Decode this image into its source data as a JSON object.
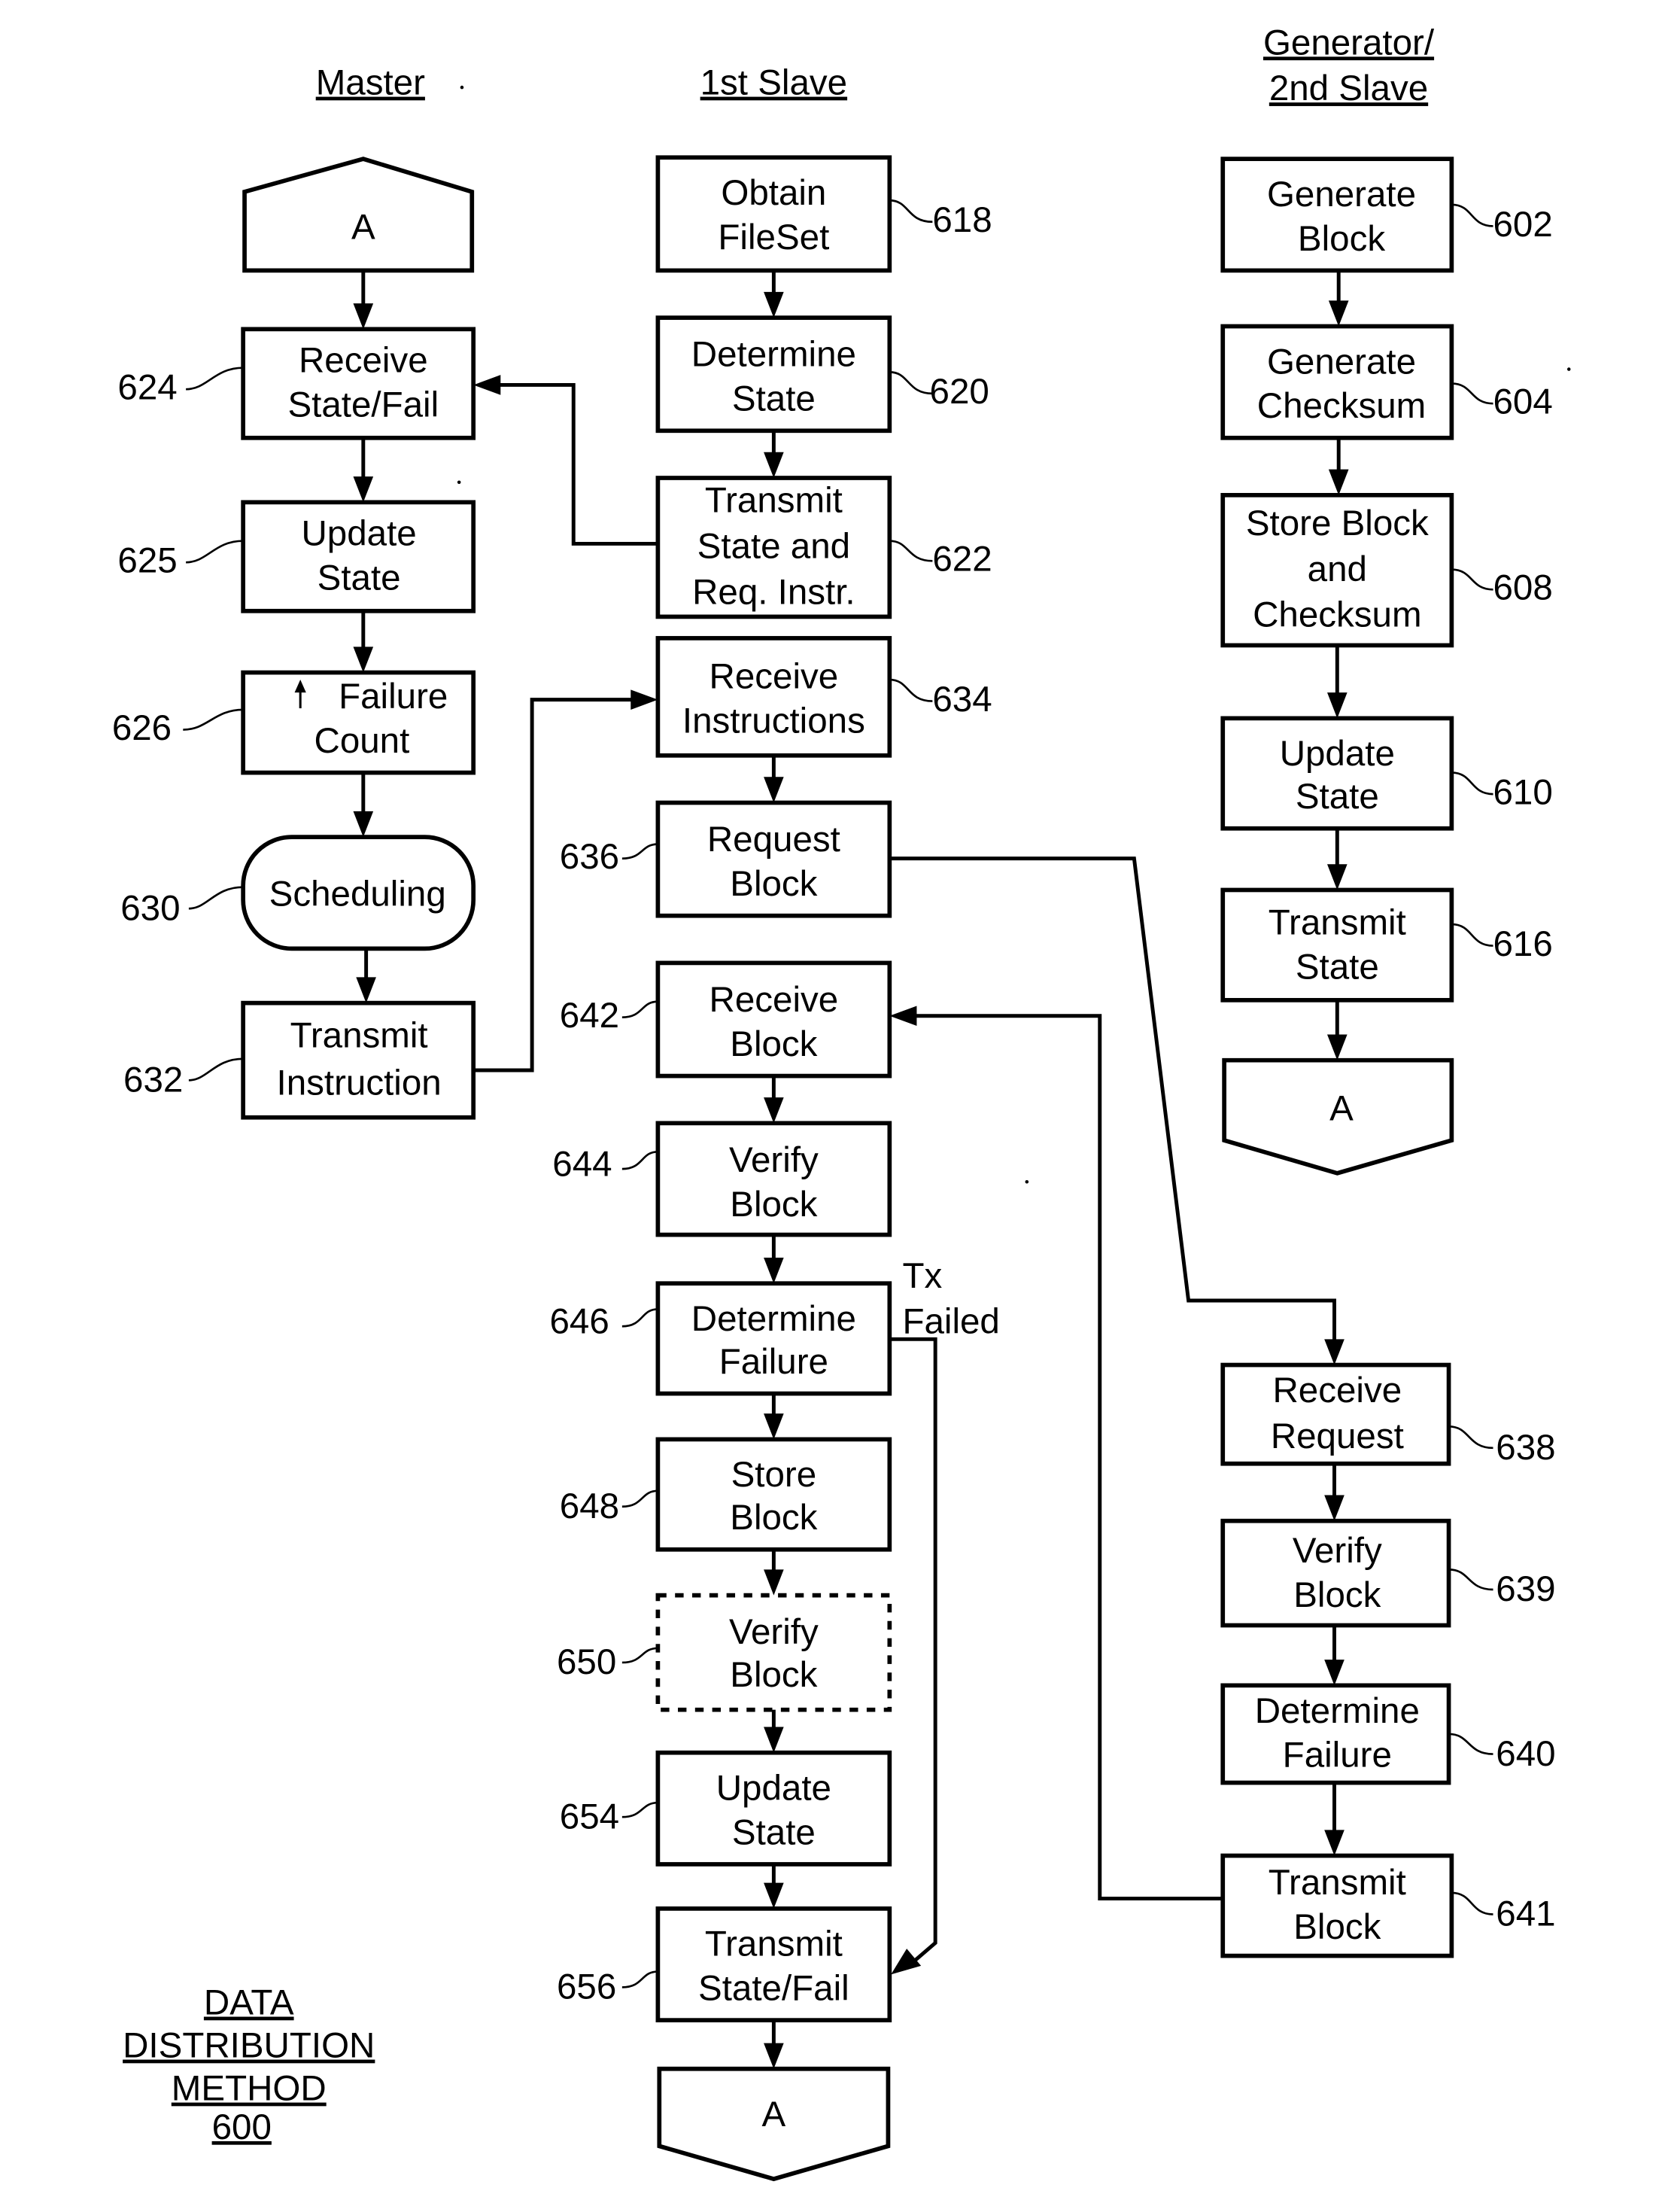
{
  "figure": {
    "title_lines": [
      "DATA",
      "DISTRIBUTION",
      "METHOD",
      "600"
    ]
  },
  "lanes": {
    "master": "Master",
    "first_slave": "1st Slave",
    "generator_lines": [
      "Generator/",
      "2nd Slave"
    ]
  },
  "connectors": {
    "master_start": "A",
    "slave_end": "A",
    "generator_end": "A"
  },
  "edge_labels": {
    "tx_failed_lines": [
      "Tx",
      "Failed"
    ]
  },
  "master_steps": [
    {
      "ref": "624",
      "lines": [
        "Receive",
        "State/Fail"
      ]
    },
    {
      "ref": "625",
      "lines": [
        "Update",
        "State"
      ]
    },
    {
      "ref": "626",
      "lines": [
        "Failure",
        "Count"
      ],
      "icon": "up-arrow"
    },
    {
      "ref": "630",
      "lines": [
        "Scheduling"
      ]
    },
    {
      "ref": "632",
      "lines": [
        "Transmit",
        "Instruction"
      ]
    }
  ],
  "slave_steps": [
    {
      "ref": "618",
      "lines": [
        "Obtain",
        "FileSet"
      ]
    },
    {
      "ref": "620",
      "lines": [
        "Determine",
        "State"
      ]
    },
    {
      "ref": "622",
      "lines": [
        "Transmit",
        "State and",
        "Req. Instr."
      ]
    },
    {
      "ref": "634",
      "lines": [
        "Receive",
        "Instructions"
      ]
    },
    {
      "ref": "636",
      "lines": [
        "Request",
        "Block"
      ]
    },
    {
      "ref": "642",
      "lines": [
        "Receive",
        "Block"
      ]
    },
    {
      "ref": "644",
      "lines": [
        "Verify",
        "Block"
      ]
    },
    {
      "ref": "646",
      "lines": [
        "Determine",
        "Failure"
      ]
    },
    {
      "ref": "648",
      "lines": [
        "Store",
        "Block"
      ]
    },
    {
      "ref": "650",
      "lines": [
        "Verify",
        "Block"
      ],
      "optional": true
    },
    {
      "ref": "654",
      "lines": [
        "Update",
        "State"
      ]
    },
    {
      "ref": "656",
      "lines": [
        "Transmit",
        "State/Fail"
      ]
    }
  ],
  "generator_steps": [
    {
      "ref": "602",
      "lines": [
        "Generate",
        "Block"
      ]
    },
    {
      "ref": "604",
      "lines": [
        "Generate",
        "Checksum"
      ]
    },
    {
      "ref": "608",
      "lines": [
        "Store Block",
        "and",
        "Checksum"
      ]
    },
    {
      "ref": "610",
      "lines": [
        "Update",
        "State"
      ]
    },
    {
      "ref": "616",
      "lines": [
        "Transmit",
        "State"
      ]
    },
    {
      "ref": "638",
      "lines": [
        "Receive",
        "Request"
      ]
    },
    {
      "ref": "639",
      "lines": [
        "Verify",
        "Block"
      ]
    },
    {
      "ref": "640",
      "lines": [
        "Determine",
        "Failure"
      ]
    },
    {
      "ref": "641",
      "lines": [
        "Transmit",
        "Block"
      ]
    }
  ]
}
